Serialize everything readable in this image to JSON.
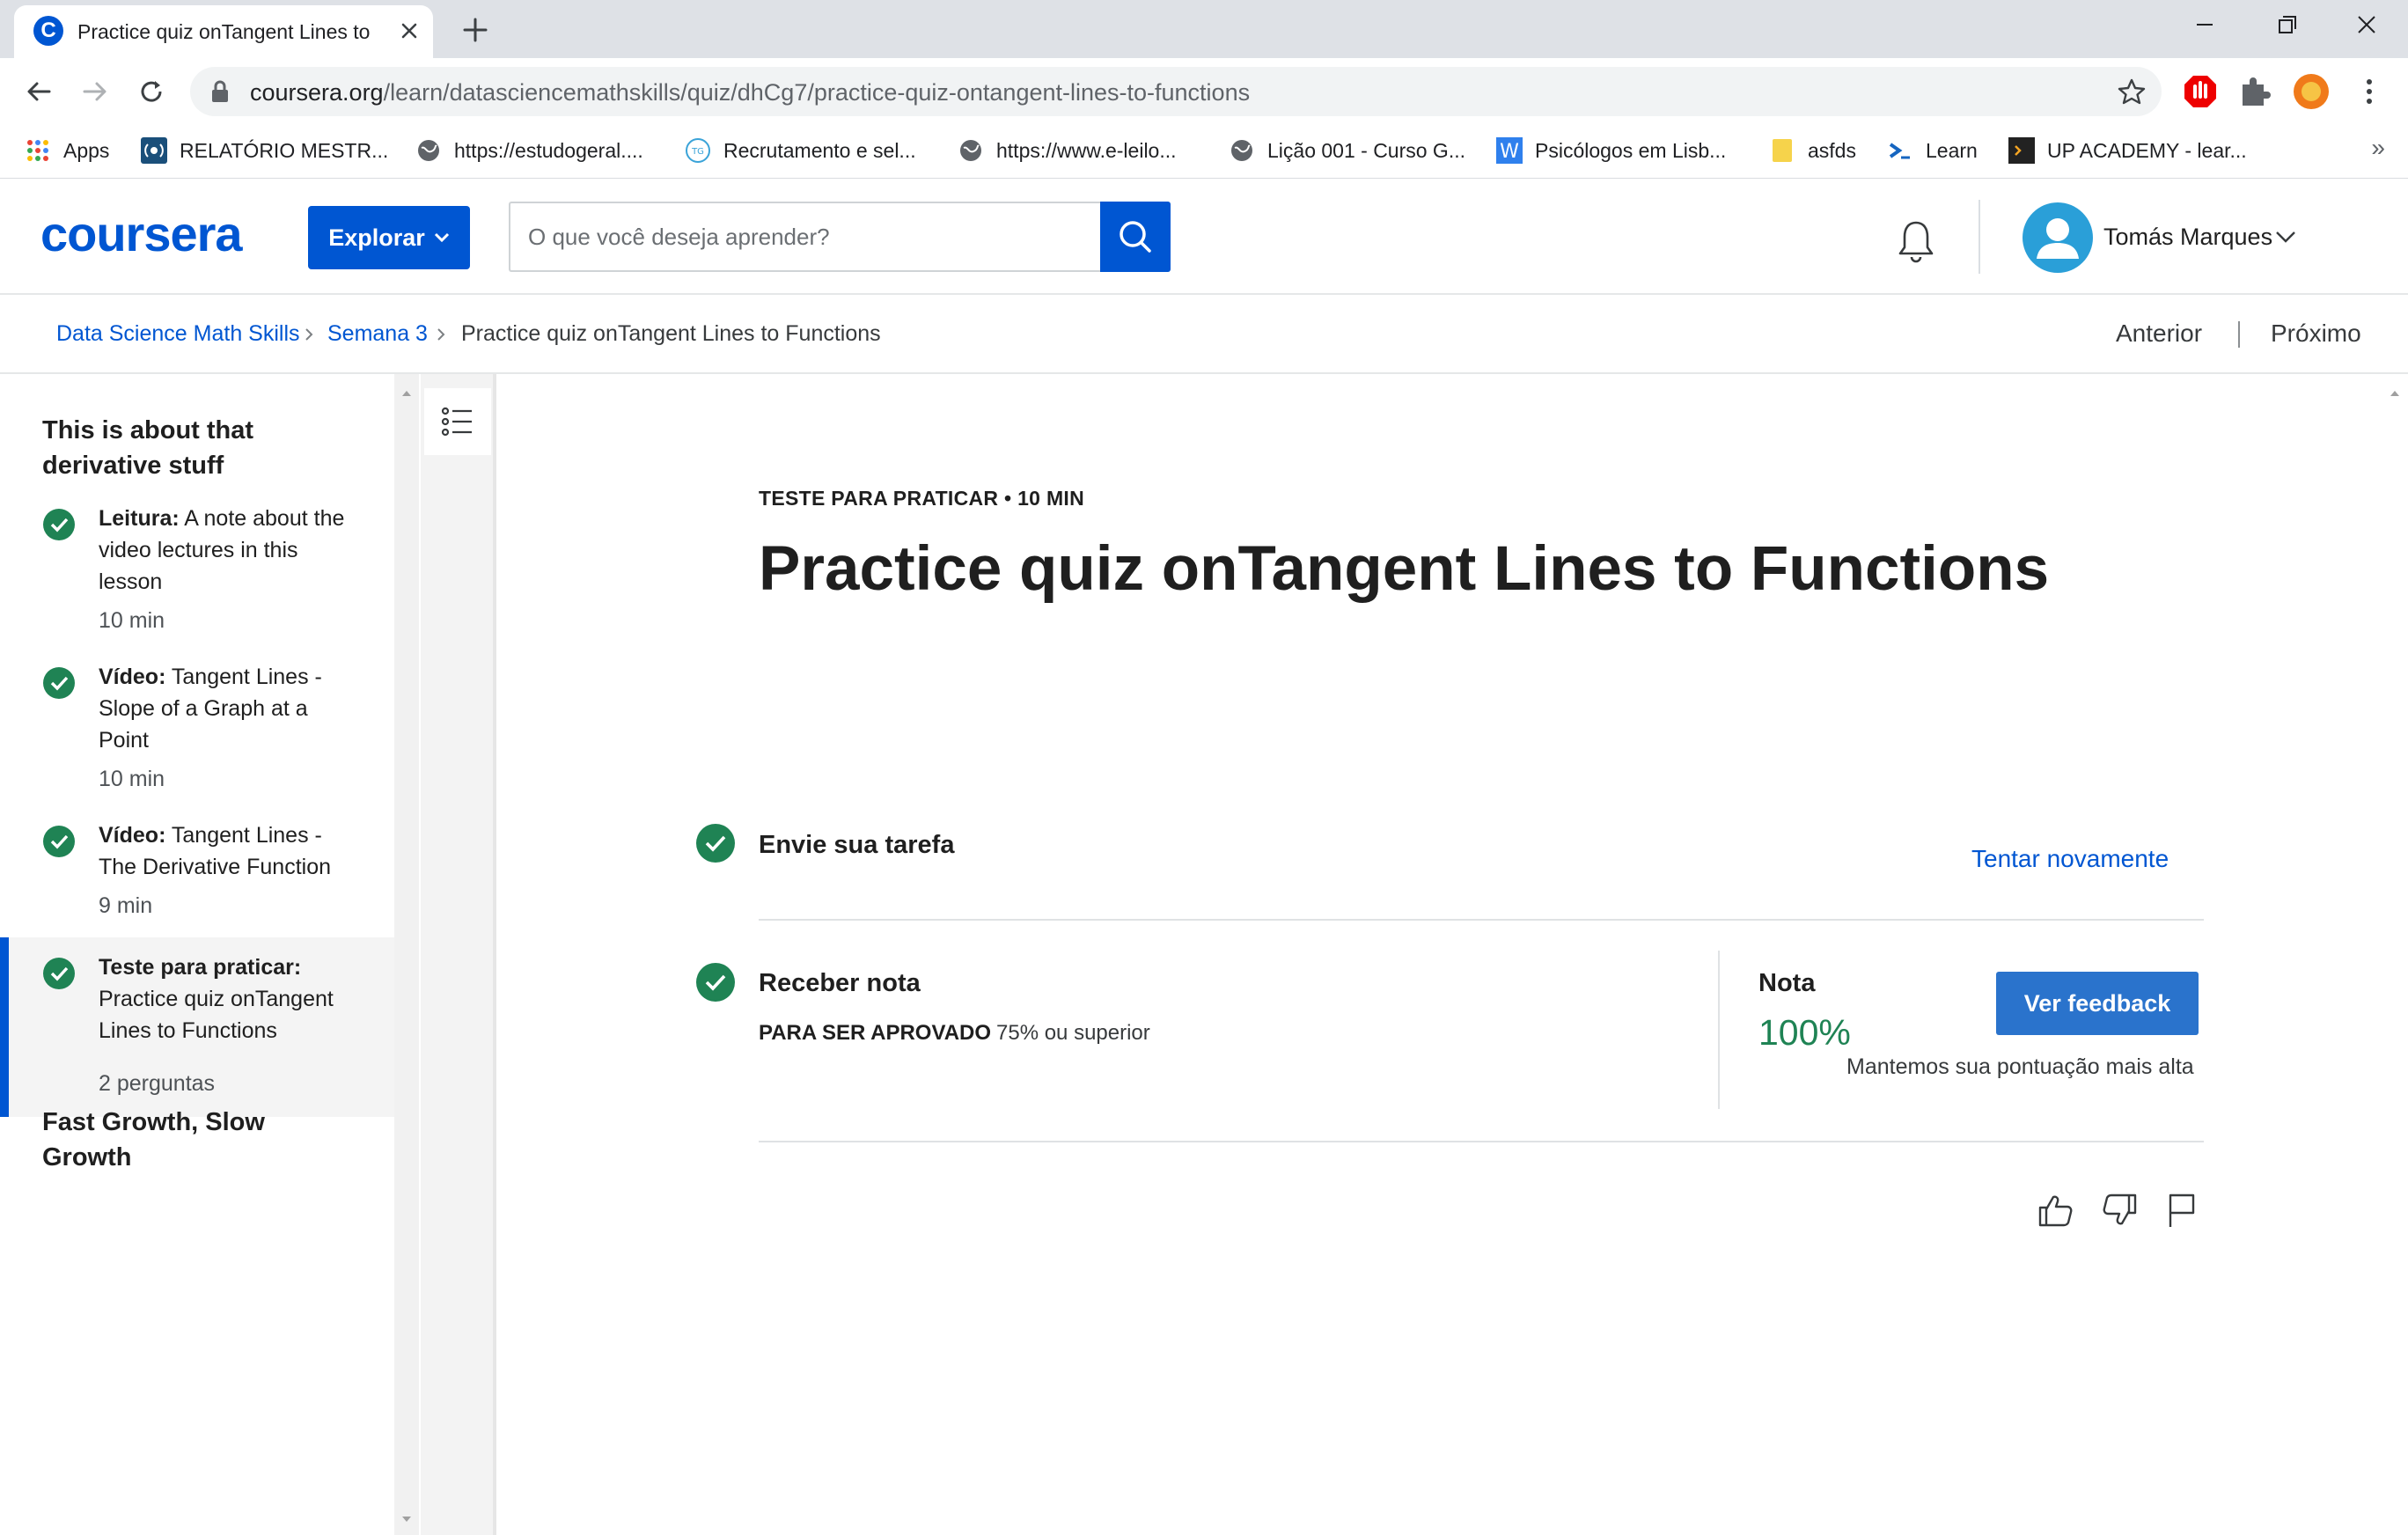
{
  "browser": {
    "tab_title": "Practice quiz onTangent Lines to",
    "url_host": "coursera.org",
    "url_path": "/learn/datasciencemathskills/quiz/dhCg7/practice-quiz-ontangent-lines-to-functions",
    "tab_favicon_letter": "C",
    "bookmarks": [
      {
        "label": "Apps",
        "icon": "apps-grid-icon"
      },
      {
        "label": "RELATÓRIO MESTR...",
        "icon": "podcast-icon"
      },
      {
        "label": "https://estudogeral....",
        "icon": "globe-icon"
      },
      {
        "label": "Recrutamento e sel...",
        "icon": "tg-icon"
      },
      {
        "label": "https://www.e-leilo...",
        "icon": "globe-icon"
      },
      {
        "label": "Lição 001 - Curso G...",
        "icon": "globe-icon"
      },
      {
        "label": "Psicólogos em Lisb...",
        "icon": "w-icon"
      },
      {
        "label": "asfds",
        "icon": "note-icon"
      },
      {
        "label": "Learn",
        "icon": "terminal-icon"
      },
      {
        "label": "UP ACADEMY - lear...",
        "icon": "up-icon"
      }
    ],
    "more_bookmarks": "»"
  },
  "header": {
    "logo": "coursera",
    "explore_label": "Explorar",
    "search_placeholder": "O que você deseja aprender?",
    "user_name": "Tomás Marques"
  },
  "breadcrumb": {
    "course": "Data Science Math Skills",
    "week": "Semana 3",
    "current": "Practice quiz onTangent Lines to Functions",
    "prev_label": "Anterior",
    "next_label": "Próximo"
  },
  "sidebar": {
    "section_title": "This is about that derivative stuff",
    "items": [
      {
        "type": "Leitura:",
        "title": "A note about the video lectures in this lesson",
        "meta": "10 min",
        "done": true
      },
      {
        "type": "Vídeo:",
        "title": "Tangent Lines - Slope of a Graph at a Point",
        "meta": "10 min",
        "done": true
      },
      {
        "type": "Vídeo:",
        "title": "Tangent Lines - The Derivative Function",
        "meta": "9 min",
        "done": true
      },
      {
        "type": "Teste para praticar:",
        "title": "Practice quiz onTangent Lines to Functions",
        "meta": "2 perguntas",
        "done": true,
        "active": true
      }
    ],
    "next_section_title": "Fast Growth, Slow Growth"
  },
  "main": {
    "kicker": "TESTE PARA PRATICAR • 10 MIN",
    "title": "Practice quiz onTangent Lines to Functions",
    "submit_step": "Envie sua tarefa",
    "retry_label": "Tentar novamente",
    "grade_step": "Receber nota",
    "pass_label": "PARA SER APROVADO",
    "pass_value": "75% ou superior",
    "grade_label": "Nota",
    "grade_value": "100%",
    "feedback_label": "Ver feedback",
    "keep_highest": "Mantemos sua pontuação mais alta"
  },
  "colors": {
    "brand": "#0056d2",
    "success": "#1f8354",
    "button": "#2a73cc"
  }
}
